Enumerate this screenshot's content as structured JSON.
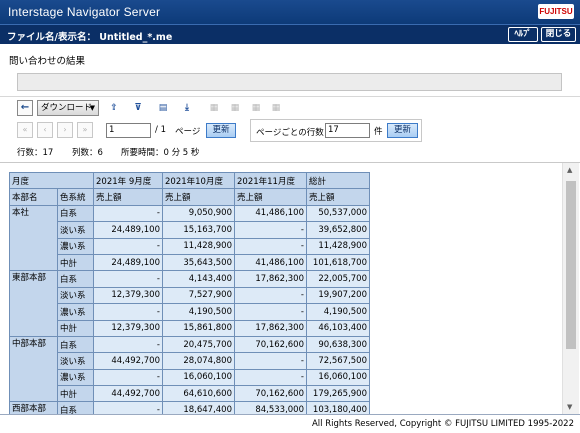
{
  "window": {
    "title": "Interstage Navigator Server",
    "brand": "FUJITSU"
  },
  "file_bar": {
    "label": "ファイル名/表示名：  Untitled_*.me",
    "help_label": "ﾍﾙﾌﾟ",
    "close_label": "閉じる"
  },
  "section_title": "問い合わせの結果",
  "toolbar": {
    "download_label": "ダウンロード",
    "icons": [
      "back-icon",
      "chevron-down-icon",
      "export-icon",
      "filter-icon",
      "folder-icon",
      "download-icon",
      "tool-icon-1",
      "tool-icon-2",
      "tool-icon-3",
      "tool-icon-4"
    ]
  },
  "pager": {
    "nav": [
      "«",
      "‹",
      "›",
      "»"
    ],
    "current_page": "1",
    "total": "/ 1",
    "page_label": "ページ",
    "update_label": "更新",
    "rows_label": "ページごとの行数",
    "rows_value": "17",
    "rows_unit": "件",
    "rows_update_label": "更新"
  },
  "stats": {
    "rows": "行数：17",
    "cols": "列数：6",
    "time": "所要時間：0 分  5 秒"
  },
  "table": {
    "header1": [
      "月度",
      "2021年 9月度",
      "2021年10月度",
      "2021年11月度",
      "総計"
    ],
    "header2": [
      "本部名",
      "色系統",
      "売上額",
      "売上額",
      "売上額",
      "売上額"
    ],
    "groups": [
      {
        "name": "本社",
        "rows": [
          {
            "color": "白系",
            "v": [
              "-",
              "9,050,900",
              "41,486,100",
              "50,537,000"
            ]
          },
          {
            "color": "淡い系",
            "v": [
              "24,489,100",
              "15,163,700",
              "-",
              "39,652,800"
            ]
          },
          {
            "color": "濃い系",
            "v": [
              "-",
              "11,428,900",
              "-",
              "11,428,900"
            ]
          },
          {
            "color": "中計",
            "v": [
              "24,489,100",
              "35,643,500",
              "41,486,100",
              "101,618,700"
            ]
          }
        ]
      },
      {
        "name": "東部本部",
        "rows": [
          {
            "color": "白系",
            "v": [
              "-",
              "4,143,400",
              "17,862,300",
              "22,005,700"
            ]
          },
          {
            "color": "淡い系",
            "v": [
              "12,379,300",
              "7,527,900",
              "-",
              "19,907,200"
            ]
          },
          {
            "color": "濃い系",
            "v": [
              "-",
              "4,190,500",
              "-",
              "4,190,500"
            ]
          },
          {
            "color": "中計",
            "v": [
              "12,379,300",
              "15,861,800",
              "17,862,300",
              "46,103,400"
            ]
          }
        ]
      },
      {
        "name": "中部本部",
        "rows": [
          {
            "color": "白系",
            "v": [
              "-",
              "20,475,700",
              "70,162,600",
              "90,638,300"
            ]
          },
          {
            "color": "淡い系",
            "v": [
              "44,492,700",
              "28,074,800",
              "-",
              "72,567,500"
            ]
          },
          {
            "color": "濃い系",
            "v": [
              "-",
              "16,060,100",
              "-",
              "16,060,100"
            ]
          },
          {
            "color": "中計",
            "v": [
              "44,492,700",
              "64,610,600",
              "70,162,600",
              "179,265,900"
            ]
          }
        ]
      },
      {
        "name": "西部本部",
        "rows": [
          {
            "color": "白系",
            "v": [
              "-",
              "18,647,400",
              "84,533,000",
              "103,180,400"
            ]
          }
        ]
      }
    ]
  },
  "footer": {
    "copyright": "All Rights Reserved, Copyright © FUJITSU LIMITED 1995-2022"
  }
}
